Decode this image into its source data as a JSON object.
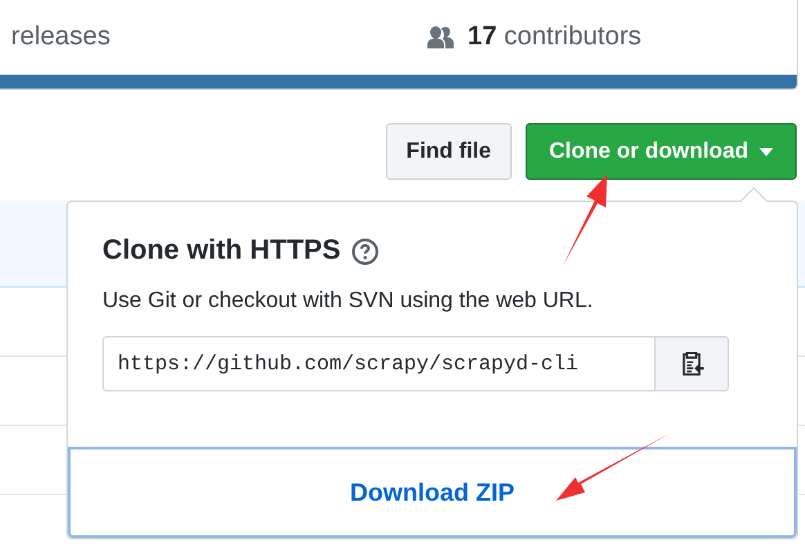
{
  "stats": {
    "releases_label": "releases",
    "contributors_count": "17",
    "contributors_label": "contributors"
  },
  "buttons": [
    {
      "label": "Find file",
      "kind": "secondary"
    },
    {
      "label": "Clone or download",
      "kind": "primary"
    }
  ],
  "file_rows": [
    {
      "selected": true
    },
    {
      "selected": false
    },
    {
      "selected": false
    },
    {
      "selected": false
    }
  ],
  "clone_popup": {
    "title": "Clone with HTTPS",
    "description": "Use Git or checkout with SVN using the web URL.",
    "url": "https://github.com/scrapy/scrapyd-cli",
    "download_label": "Download ZIP"
  }
}
